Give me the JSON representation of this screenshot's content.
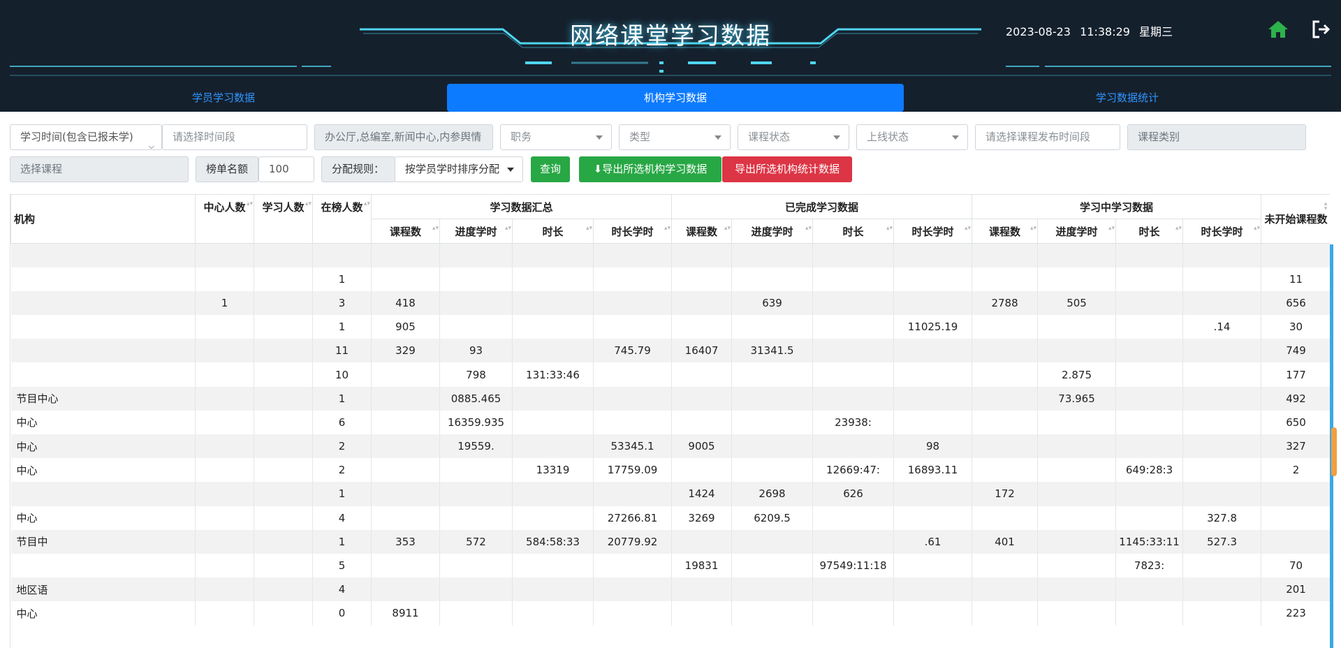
{
  "app": {
    "title": "网络课堂学习数据"
  },
  "header": {
    "date": "2023-08-23",
    "time": "11:38:29",
    "weekday": "星期三",
    "home_icon": "home-icon",
    "logout_icon": "logout-icon",
    "accent": "#2fd1ff"
  },
  "tabs": [
    {
      "label": "学员学习数据",
      "active": false
    },
    {
      "label": "机构学习数据",
      "active": true
    },
    {
      "label": "学习数据统计",
      "active": false
    }
  ],
  "filters": {
    "time_type": "学习时间(包含已报未学)",
    "time_range_placeholder": "请选择时间段",
    "org_value": "办公厅,总编室,新闻中心,内参舆情",
    "position_placeholder": "职务",
    "type_placeholder": "类型",
    "course_status_placeholder": "课程状态",
    "online_status_placeholder": "上线状态",
    "publish_time_placeholder": "请选择课程发布时间段",
    "course_category_placeholder": "课程类别",
    "course_select_placeholder": "选择课程",
    "rank_label": "榜单名额",
    "rank_value": "100",
    "rule_label": "分配规则：",
    "rule_value": "按学员学时排序分配",
    "query_button": "查询",
    "export_org_button": "导出所选机构学习数据",
    "export_stats_button": "导出所选机构统计数据",
    "download_icon": "download-icon"
  },
  "table": {
    "headers_top": {
      "org": "机构",
      "center_count": "中心人数",
      "learner_count": "学习人数",
      "ranked_count": "在榜人数",
      "summary": "学习数据汇总",
      "completed": "已完成学习数据",
      "in_progress": "学习中学习数据",
      "not_started": "未开始课程数"
    },
    "headers_sub": [
      "课程数",
      "进度学时",
      "时长",
      "时长学时",
      "课程数",
      "进度学时",
      "时长",
      "时长学时",
      "课程数",
      "进度学时",
      "时长",
      "时长学时"
    ],
    "rows": [
      [
        "",
        "",
        "",
        "",
        "",
        "",
        "",
        "",
        "",
        "",
        "",
        "",
        "",
        "",
        "",
        "",
        ""
      ],
      [
        "",
        "",
        "",
        "1",
        "",
        "",
        "",
        "",
        "",
        "",
        "",
        "",
        "",
        "",
        "",
        "",
        "11"
      ],
      [
        "",
        "1",
        "",
        "3",
        "418",
        "",
        "",
        "",
        "",
        "639",
        "",
        "",
        "2788",
        "505",
        "",
        "",
        "656"
      ],
      [
        "",
        "",
        "",
        "1",
        "905",
        "",
        "",
        "",
        "",
        "",
        "",
        "11025.19",
        "",
        "",
        "",
        ".14",
        "30"
      ],
      [
        "",
        "",
        "",
        "11",
        "329",
        "93",
        "",
        "745.79",
        "16407",
        "31341.5",
        "",
        "",
        "",
        "",
        "",
        "",
        "749"
      ],
      [
        "",
        "",
        "",
        "10",
        "",
        "798",
        "131:33:46",
        "",
        "",
        "",
        "",
        "",
        "",
        "2.875",
        "",
        "",
        "177"
      ],
      [
        "节目中心",
        "",
        "",
        "1",
        "",
        "0885.465",
        "",
        "",
        "",
        "",
        "",
        "",
        "",
        "73.965",
        "",
        "",
        "492"
      ],
      [
        "中心",
        "",
        "",
        "6",
        "",
        "16359.935",
        "",
        "",
        "",
        "",
        "23938:",
        "",
        "",
        "",
        "",
        "",
        "650"
      ],
      [
        "中心",
        "",
        "",
        "2",
        "",
        "19559.",
        "",
        "53345.1",
        "9005",
        "",
        "",
        "98",
        "",
        "",
        "",
        "",
        "327"
      ],
      [
        "中心",
        "",
        "",
        "2",
        "",
        "",
        "13319",
        "17759.09",
        "",
        "",
        "12669:47:",
        "16893.11",
        "",
        "",
        "649:28:3",
        "",
        "2"
      ],
      [
        "",
        "",
        "",
        "1",
        "",
        "",
        "",
        "",
        "1424",
        "2698",
        "626",
        "",
        "172",
        "",
        "",
        "",
        ""
      ],
      [
        "中心",
        "",
        "",
        "4",
        "",
        "",
        "",
        "27266.81",
        "3269",
        "6209.5",
        "",
        "",
        "",
        "",
        "",
        "327.8",
        ""
      ],
      [
        "节目中",
        "",
        "",
        "1",
        "353",
        "572",
        "584:58:33",
        "20779.92",
        "",
        "",
        "",
        ".61",
        "401",
        "",
        "1145:33:11",
        "527.3",
        ""
      ],
      [
        "",
        "",
        "",
        "5",
        "",
        "",
        "",
        "",
        "19831",
        "",
        "97549:11:18",
        "",
        "",
        "",
        "7823:",
        "",
        "70"
      ],
      [
        "地区语",
        "",
        "",
        "4",
        "",
        "",
        "",
        "",
        "",
        "",
        "",
        "",
        "",
        "",
        "",
        "",
        "201"
      ],
      [
        "中心",
        "",
        "",
        "0",
        "8911",
        "",
        "",
        "",
        "",
        "",
        "",
        "",
        "",
        "",
        "",
        "",
        "223"
      ]
    ]
  }
}
